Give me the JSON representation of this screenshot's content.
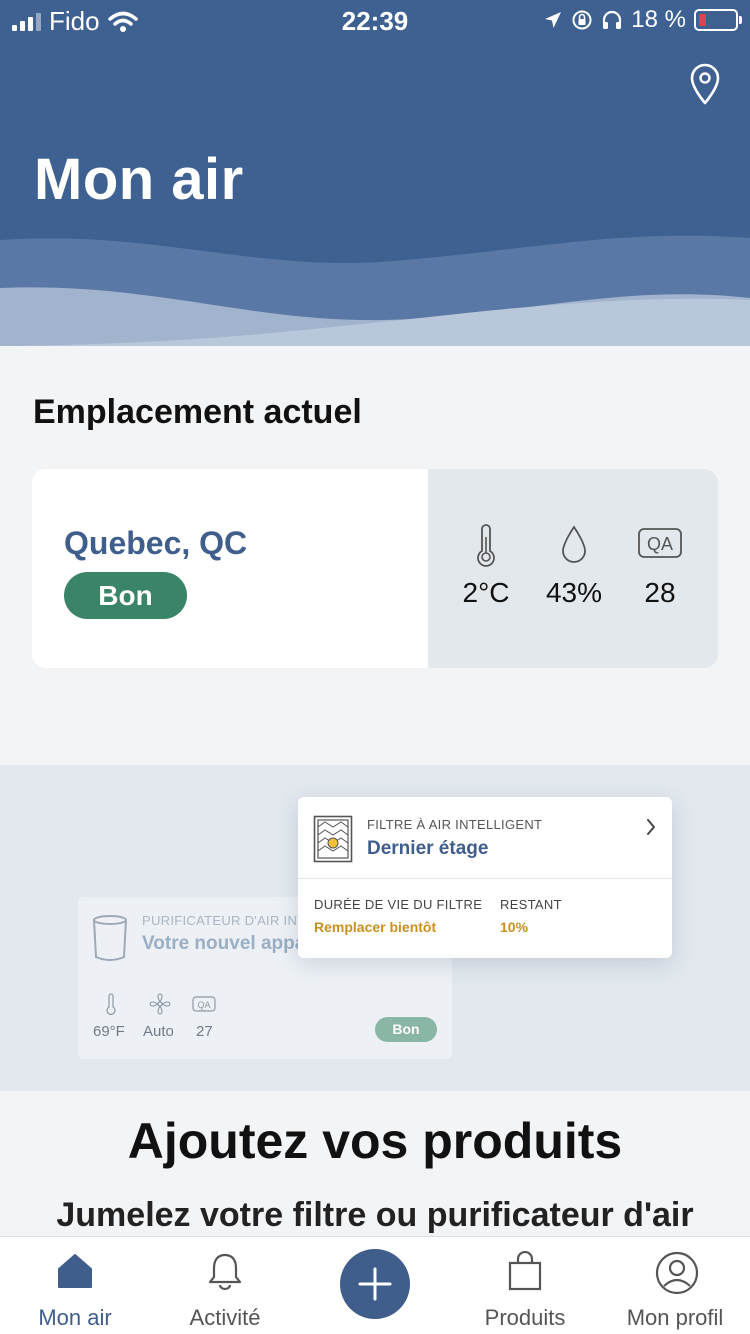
{
  "status_bar": {
    "carrier": "Fido",
    "time": "22:39",
    "battery_text": "18 %"
  },
  "header": {
    "title": "Mon air",
    "location_icon": "location-pin-icon"
  },
  "current_location": {
    "section_title": "Emplacement actuel",
    "city": "Quebec, QC",
    "quality": "Bon",
    "temperature": "2°C",
    "humidity": "43%",
    "aqi_label": "QA",
    "aqi": "28"
  },
  "promo": {
    "filter_card": {
      "label": "FILTRE À AIR INTELLIGENT",
      "name": "Dernier étage",
      "life_label": "DURÉE DE VIE DU FILTRE",
      "life_value": "Remplacer bientôt",
      "remaining_label": "RESTANT",
      "remaining_value": "10%"
    },
    "purifier_card": {
      "label": "PURIFICATEUR D'AIR INT",
      "name": "Votre nouvel appa",
      "temperature": "69°F",
      "fan": "Auto",
      "aqi_label": "QA",
      "aqi": "27",
      "quality": "Bon"
    },
    "title": "Ajoutez vos produits",
    "subtitle": "Jumelez votre filtre ou purificateur d'air"
  },
  "tabbar": {
    "tabs": [
      {
        "label": "Mon air",
        "icon": "home-icon",
        "active": true
      },
      {
        "label": "Activité",
        "icon": "bell-icon",
        "active": false
      },
      {
        "label": "Produits",
        "icon": "shopping-bag-icon",
        "active": false
      },
      {
        "label": "Mon profil",
        "icon": "user-circle-icon",
        "active": false
      }
    ],
    "add_icon": "plus-icon"
  },
  "colors": {
    "brand_blue": "#3f6192",
    "good_green": "#3a8468",
    "warning_orange": "#c9901f"
  }
}
